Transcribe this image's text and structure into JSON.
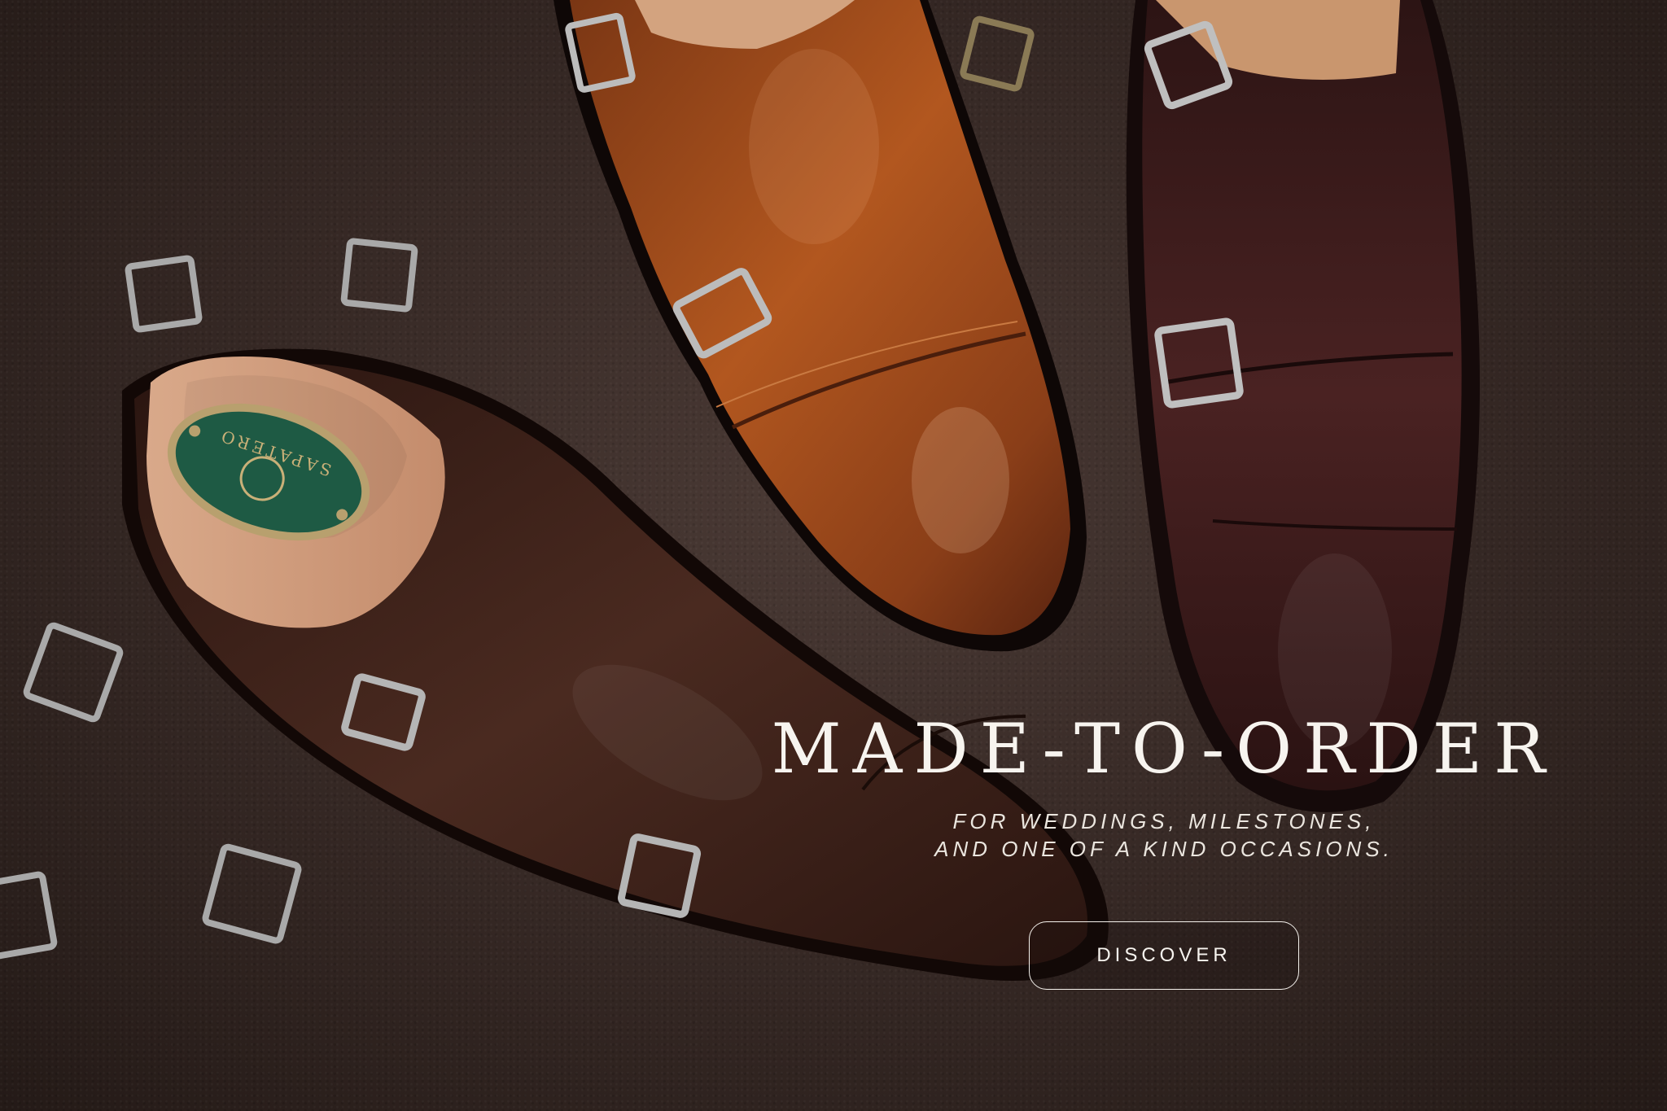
{
  "hero": {
    "headline": "MADE-TO-ORDER",
    "subline_1": "FOR WEDDINGS, MILESTONES,",
    "subline_2": "AND ONE OF A KIND OCCASIONS.",
    "cta_label": "DISCOVER"
  },
  "shoe_tree": {
    "badge_text": "SAPATERO"
  },
  "colors": {
    "background": "#3a2c28",
    "tan_shoe": "#9b4a1f",
    "dark_brown_shoe": "#3a1f18",
    "burgundy_shoe": "#3a1a1a",
    "badge_green": "#1e5a44",
    "text": "#f7f4ef"
  }
}
